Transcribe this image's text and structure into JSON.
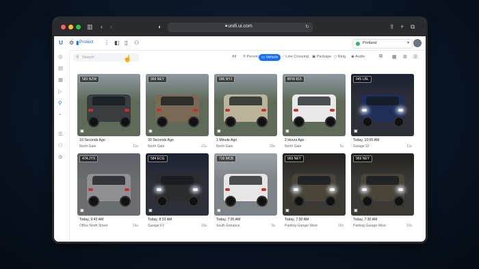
{
  "browser": {
    "url": "unifi.ui.com"
  },
  "app": {
    "name": "Protect",
    "site": "Portland"
  },
  "search": {
    "placeholder": "Search"
  },
  "filters": [
    {
      "label": "All"
    },
    {
      "label": "Person"
    },
    {
      "label": "Vehicle",
      "active": true
    },
    {
      "label": "Line Crossing"
    },
    {
      "label": "Package"
    },
    {
      "label": "Ring"
    },
    {
      "label": "Audio"
    }
  ],
  "cards": [
    {
      "plate": "583 NZW",
      "time": "10 Seconds Ago",
      "location": "North Gate",
      "ago": "11s",
      "car": "#3a3d40",
      "scene": "day"
    },
    {
      "plate": "969 NEY",
      "time": "30 Seconds Ago",
      "location": "North Gate",
      "ago": "21s",
      "car": "#7a6a55",
      "scene": "day"
    },
    {
      "plate": "096 NYJ",
      "time": "1 Minute Ago",
      "location": "North Gate",
      "ago": "20s",
      "car": "#b9b49a",
      "scene": "day"
    },
    {
      "plate": "BFW 815",
      "time": "2 Hours Ago",
      "location": "North Gate",
      "ago": "5s",
      "car": "#e9e9ea",
      "scene": "day"
    },
    {
      "plate": "045 LBL",
      "time": "Today, 10:05 AM",
      "location": "Garage 1F",
      "ago": "11s",
      "car": "#1f2f5a",
      "scene": "garage"
    },
    {
      "plate": "47A JYX",
      "time": "Today, 9:43 AM",
      "location": "Office North Street",
      "ago": "24s",
      "car": "#8f8f94",
      "scene": "street"
    },
    {
      "plate": "584 ECG",
      "time": "Today, 8:33 AM",
      "location": "Garage F2",
      "ago": "15s",
      "car": "#2b2c30",
      "scene": "garage"
    },
    {
      "plate": "716 MCB",
      "time": "Today, 7:35 AM",
      "location": "South Entrance",
      "ago": "9s",
      "car": "#e6e6e6",
      "scene": "lot"
    },
    {
      "plate": "969 NEY",
      "time": "Today, 7:30 AM",
      "location": "Parking Garage West",
      "ago": "16s",
      "car": "#4a4538",
      "scene": "night"
    },
    {
      "plate": "969 NEY",
      "time": "Today, 7:30 AM",
      "location": "Parking Garage West",
      "ago": "10s",
      "car": "#4a4538",
      "scene": "night"
    }
  ]
}
